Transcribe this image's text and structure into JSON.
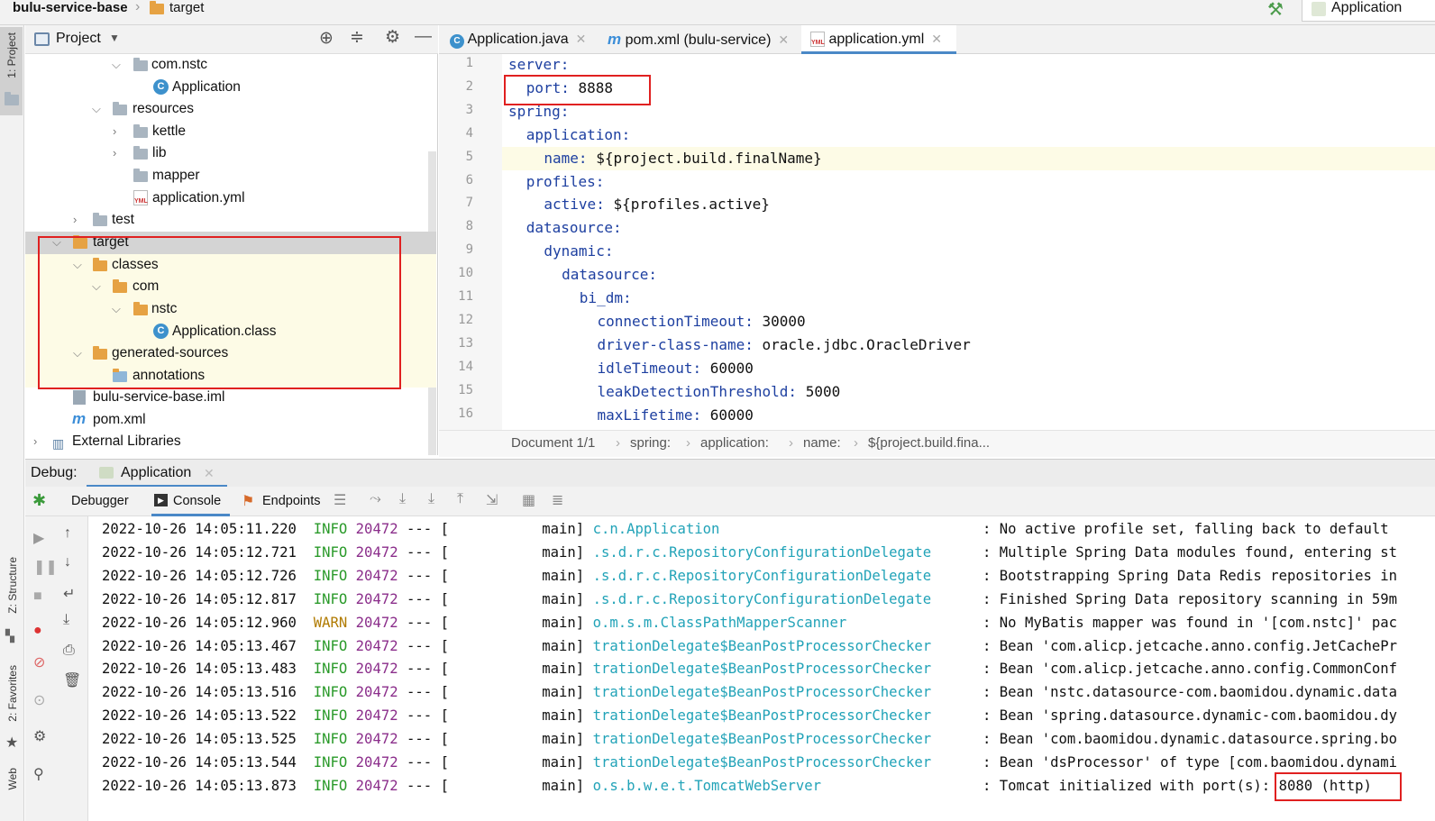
{
  "topbar": {
    "project_name": "bulu-service-base",
    "target_folder": "target",
    "run_config": "Application"
  },
  "sidebar_strip": {
    "project_tab": "1: Project",
    "structure_tab": "Z: Structure",
    "favorites_tab": "2: Favorites",
    "web_tab": "Web"
  },
  "project_panel": {
    "title": "Project",
    "tree": [
      {
        "label": "com.nstc",
        "icon": "package-icon"
      },
      {
        "label": "Application",
        "icon": "class-icon"
      },
      {
        "label": "resources",
        "icon": "folder-icon"
      },
      {
        "label": "kettle",
        "icon": "folder-icon"
      },
      {
        "label": "lib",
        "icon": "folder-icon"
      },
      {
        "label": "mapper",
        "icon": "folder-icon"
      },
      {
        "label": "application.yml",
        "icon": "yml-icon"
      },
      {
        "label": "test",
        "icon": "folder-icon"
      },
      {
        "label": "target",
        "icon": "folder-icon"
      },
      {
        "label": "classes",
        "icon": "folder-icon"
      },
      {
        "label": "com",
        "icon": "folder-icon"
      },
      {
        "label": "nstc",
        "icon": "folder-icon"
      },
      {
        "label": "Application.class",
        "icon": "class-icon"
      },
      {
        "label": "generated-sources",
        "icon": "folder-icon"
      },
      {
        "label": "annotations",
        "icon": "folder-icon"
      },
      {
        "label": "bulu-service-base.iml",
        "icon": "iml-icon"
      },
      {
        "label": "pom.xml",
        "icon": "maven-icon"
      },
      {
        "label": "External Libraries",
        "icon": "libraries-icon"
      }
    ]
  },
  "editor": {
    "tabs": [
      {
        "label": "Application.java"
      },
      {
        "label": "pom.xml (bulu-service)"
      },
      {
        "label": "application.yml"
      }
    ],
    "lines": [
      {
        "n": "1",
        "key": "server:",
        "val": ""
      },
      {
        "n": "2",
        "key": "port:",
        "val": " 8888"
      },
      {
        "n": "3",
        "key": "spring:",
        "val": ""
      },
      {
        "n": "4",
        "key": "application:",
        "val": ""
      },
      {
        "n": "5",
        "key": "name:",
        "val": " ${project.build.finalName}"
      },
      {
        "n": "6",
        "key": "profiles:",
        "val": ""
      },
      {
        "n": "7",
        "key": "active:",
        "val": " ${profiles.active}"
      },
      {
        "n": "8",
        "key": "datasource:",
        "val": ""
      },
      {
        "n": "9",
        "key": "dynamic:",
        "val": ""
      },
      {
        "n": "10",
        "key": "datasource:",
        "val": ""
      },
      {
        "n": "11",
        "key": "bi_dm:",
        "val": ""
      },
      {
        "n": "12",
        "key": "connectionTimeout:",
        "val": " 30000"
      },
      {
        "n": "13",
        "key": "driver-class-name:",
        "val": " oracle.jdbc.OracleDriver"
      },
      {
        "n": "14",
        "key": "idleTimeout:",
        "val": " 60000"
      },
      {
        "n": "15",
        "key": "leakDetectionThreshold:",
        "val": " 5000"
      },
      {
        "n": "16",
        "key": "maxLifetime:",
        "val": " 60000"
      }
    ],
    "breadcrumb": [
      "Document 1/1",
      "spring:",
      "application:",
      "name:",
      "${project.build.fina..."
    ]
  },
  "debug": {
    "label": "Debug:",
    "session_tab": "Application",
    "sub_tabs": [
      "Debugger",
      "Console",
      "Endpoints"
    ],
    "log": [
      {
        "ts": "2022-10-26 14:05:11.220",
        "level": "INFO",
        "pid": "20472",
        "thread": "main",
        "logger": "c.n.Application",
        "msg": ": No active profile set, falling back to default"
      },
      {
        "ts": "2022-10-26 14:05:12.721",
        "level": "INFO",
        "pid": "20472",
        "thread": "main",
        "logger": ".s.d.r.c.RepositoryConfigurationDelegate",
        "msg": ": Multiple Spring Data modules found, entering st"
      },
      {
        "ts": "2022-10-26 14:05:12.726",
        "level": "INFO",
        "pid": "20472",
        "thread": "main",
        "logger": ".s.d.r.c.RepositoryConfigurationDelegate",
        "msg": ": Bootstrapping Spring Data Redis repositories in"
      },
      {
        "ts": "2022-10-26 14:05:12.817",
        "level": "INFO",
        "pid": "20472",
        "thread": "main",
        "logger": ".s.d.r.c.RepositoryConfigurationDelegate",
        "msg": ": Finished Spring Data repository scanning in 59m"
      },
      {
        "ts": "2022-10-26 14:05:12.960",
        "level": "WARN",
        "pid": "20472",
        "thread": "main",
        "logger": "o.m.s.m.ClassPathMapperScanner",
        "msg": ": No MyBatis mapper was found in '[com.nstc]' pac"
      },
      {
        "ts": "2022-10-26 14:05:13.467",
        "level": "INFO",
        "pid": "20472",
        "thread": "main",
        "logger": "trationDelegate$BeanPostProcessorChecker",
        "msg": ": Bean 'com.alicp.jetcache.anno.config.JetCachePr"
      },
      {
        "ts": "2022-10-26 14:05:13.483",
        "level": "INFO",
        "pid": "20472",
        "thread": "main",
        "logger": "trationDelegate$BeanPostProcessorChecker",
        "msg": ": Bean 'com.alicp.jetcache.anno.config.CommonConf"
      },
      {
        "ts": "2022-10-26 14:05:13.516",
        "level": "INFO",
        "pid": "20472",
        "thread": "main",
        "logger": "trationDelegate$BeanPostProcessorChecker",
        "msg": ": Bean 'nstc.datasource-com.baomidou.dynamic.data"
      },
      {
        "ts": "2022-10-26 14:05:13.522",
        "level": "INFO",
        "pid": "20472",
        "thread": "main",
        "logger": "trationDelegate$BeanPostProcessorChecker",
        "msg": ": Bean 'spring.datasource.dynamic-com.baomidou.dy"
      },
      {
        "ts": "2022-10-26 14:05:13.525",
        "level": "INFO",
        "pid": "20472",
        "thread": "main",
        "logger": "trationDelegate$BeanPostProcessorChecker",
        "msg": ": Bean 'com.baomidou.dynamic.datasource.spring.bo"
      },
      {
        "ts": "2022-10-26 14:05:13.544",
        "level": "INFO",
        "pid": "20472",
        "thread": "main",
        "logger": "trationDelegate$BeanPostProcessorChecker",
        "msg": ": Bean 'dsProcessor' of type [com.baomidou.dynami"
      },
      {
        "ts": "2022-10-26 14:05:13.873",
        "level": "INFO",
        "pid": "20472",
        "thread": "main",
        "logger": "o.s.b.w.e.t.TomcatWebServer",
        "msg": ": Tomcat initialized with port(s): 8080 (http)"
      }
    ]
  },
  "colors": {
    "highlight_box": "#e02020",
    "accent": "#4a88c7",
    "yaml_key": "#1d3fa0"
  }
}
